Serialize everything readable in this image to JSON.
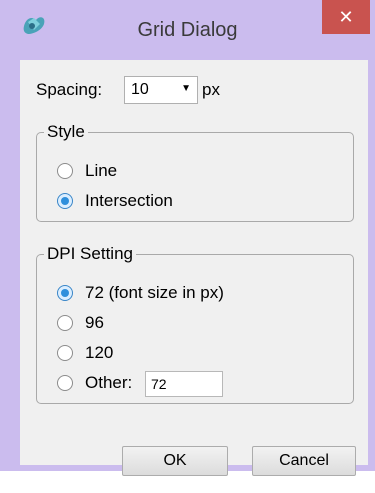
{
  "window": {
    "title": "Grid Dialog",
    "close_glyph": "✕"
  },
  "spacing": {
    "label": "Spacing:",
    "value": "10",
    "unit": "px"
  },
  "style_group": {
    "legend": "Style",
    "options": [
      {
        "label": "Line",
        "checked": false
      },
      {
        "label": "Intersection",
        "checked": true
      }
    ]
  },
  "dpi_group": {
    "legend": "DPI Setting",
    "options": [
      {
        "label": "72 (font size in px)",
        "checked": true
      },
      {
        "label": "96",
        "checked": false
      },
      {
        "label": "120",
        "checked": false
      },
      {
        "label": "Other:",
        "checked": false
      }
    ],
    "other_value": "72"
  },
  "buttons": {
    "ok": "OK",
    "cancel": "Cancel"
  },
  "colors": {
    "frame": "#cbbcee",
    "close": "#c9534f",
    "callout": "#e07a2e",
    "radio_selected": "#2f8fdc"
  }
}
